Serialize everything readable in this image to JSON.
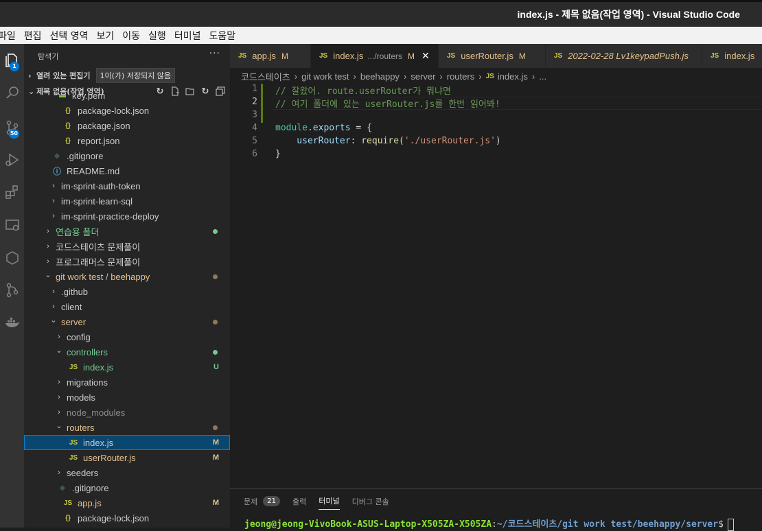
{
  "window": {
    "title": "index.js - 제목 없음(작업 영역) - Visual Studio Code"
  },
  "menu": [
    "파일",
    "편집",
    "선택 영역",
    "보기",
    "이동",
    "실행",
    "터미널",
    "도움말"
  ],
  "activity_bar": [
    {
      "icon": "files-icon",
      "badge": "1"
    },
    {
      "icon": "search-icon",
      "badge": ""
    },
    {
      "icon": "source-control-icon",
      "badge": "50"
    },
    {
      "icon": "run-debug-icon",
      "badge": ""
    },
    {
      "icon": "extensions-icon",
      "badge": ""
    },
    {
      "icon": "remote-explorer-icon",
      "badge": ""
    },
    {
      "icon": "cube-icon",
      "badge": ""
    },
    {
      "icon": "git-graph-icon",
      "badge": ""
    },
    {
      "icon": "docker-icon",
      "badge": ""
    }
  ],
  "sidebar": {
    "header": "탐색기",
    "more": "···",
    "open_editors": {
      "label": "열려 있는 편집기",
      "tooltip": "1이(가) 저장되지 않음"
    },
    "workspace": {
      "label": "제목 없음(작업 영역)"
    },
    "tree": [
      {
        "label": "key.pem",
        "kind": "file",
        "icon": "key-file-icon",
        "indent": 1,
        "color": "white",
        "deco": ""
      },
      {
        "label": "package-lock.json",
        "kind": "json",
        "indent": 1,
        "color": "white",
        "deco": ""
      },
      {
        "label": "package.json",
        "kind": "json",
        "indent": 1,
        "color": "white",
        "deco": ""
      },
      {
        "label": "report.json",
        "kind": "json",
        "indent": 1,
        "color": "white",
        "deco": ""
      },
      {
        "label": ".gitignore",
        "kind": "git",
        "indent": 0,
        "color": "white",
        "deco": ""
      },
      {
        "label": "README.md",
        "kind": "info",
        "indent": 0,
        "color": "white",
        "deco": ""
      },
      {
        "label": "im-sprint-auth-token",
        "kind": "folder",
        "open": false,
        "indent": 0,
        "color": "white",
        "deco": ""
      },
      {
        "label": "im-sprint-learn-sql",
        "kind": "folder",
        "open": false,
        "indent": 0,
        "color": "white",
        "deco": ""
      },
      {
        "label": "im-sprint-practice-deploy",
        "kind": "folder",
        "open": false,
        "indent": 0,
        "color": "white",
        "deco": ""
      },
      {
        "label": "연습용 폴더",
        "kind": "folder",
        "open": false,
        "indent": -1,
        "color": "green",
        "deco": "dot-green"
      },
      {
        "label": "코드스테이츠 문제풀이",
        "kind": "folder",
        "open": false,
        "indent": -1,
        "color": "white",
        "deco": ""
      },
      {
        "label": "프로그래머스 문제풀이",
        "kind": "folder",
        "open": false,
        "indent": -1,
        "color": "white",
        "deco": ""
      },
      {
        "label": "git work test / beehappy",
        "kind": "folder",
        "open": true,
        "indent": -1,
        "color": "mod",
        "deco": "dot-mod"
      },
      {
        "label": ".github",
        "kind": "folder",
        "open": false,
        "indent": 0,
        "color": "white",
        "deco": ""
      },
      {
        "label": "client",
        "kind": "folder",
        "open": false,
        "indent": 0,
        "color": "white",
        "deco": ""
      },
      {
        "label": "server",
        "kind": "folder",
        "open": true,
        "indent": 0,
        "color": "mod",
        "deco": "dot-mod"
      },
      {
        "label": "config",
        "kind": "folder",
        "open": false,
        "indent": 1,
        "color": "white",
        "deco": ""
      },
      {
        "label": "controllers",
        "kind": "folder",
        "open": true,
        "indent": 1,
        "color": "green",
        "deco": "dot-green"
      },
      {
        "label": "index.js",
        "kind": "js",
        "indent": 2,
        "color": "green",
        "deco": "U"
      },
      {
        "label": "migrations",
        "kind": "folder",
        "open": false,
        "indent": 1,
        "color": "white",
        "deco": ""
      },
      {
        "label": "models",
        "kind": "folder",
        "open": false,
        "indent": 1,
        "color": "white",
        "deco": ""
      },
      {
        "label": "node_modules",
        "kind": "folder",
        "open": false,
        "indent": 1,
        "color": "dim",
        "deco": ""
      },
      {
        "label": "routers",
        "kind": "folder",
        "open": true,
        "indent": 1,
        "color": "mod",
        "deco": "dot-mod"
      },
      {
        "label": "index.js",
        "kind": "js",
        "indent": 2,
        "color": "white",
        "deco": "M",
        "selected": true
      },
      {
        "label": "userRouter.js",
        "kind": "js",
        "indent": 2,
        "color": "mod",
        "deco": "M"
      },
      {
        "label": "seeders",
        "kind": "folder",
        "open": false,
        "indent": 1,
        "color": "white",
        "deco": ""
      },
      {
        "label": ".gitignore",
        "kind": "git",
        "indent": 1,
        "color": "white",
        "deco": ""
      },
      {
        "label": "app.js",
        "kind": "js",
        "indent": 1,
        "color": "mod",
        "deco": "M"
      },
      {
        "label": "package-lock.json",
        "kind": "json",
        "indent": 1,
        "color": "white",
        "deco": ""
      }
    ]
  },
  "tabs": [
    {
      "icon": "JS",
      "name": "app.js",
      "path": "",
      "mod": "M",
      "active": false,
      "italic": false,
      "close": ""
    },
    {
      "icon": "JS",
      "name": "index.js",
      "path": ".../routers",
      "mod": "M",
      "active": true,
      "italic": false,
      "close": "✕"
    },
    {
      "icon": "JS",
      "name": "userRouter.js",
      "path": "",
      "mod": "M",
      "active": false,
      "italic": false,
      "close": ""
    },
    {
      "icon": "JS",
      "name": "2022-02-28 Lv1keypadPush.js",
      "path": "",
      "mod": "",
      "active": false,
      "italic": true,
      "close": ""
    },
    {
      "icon": "JS",
      "name": "index.js",
      "path": "",
      "mod": "",
      "active": false,
      "italic": false,
      "close": ""
    }
  ],
  "breadcrumb": [
    "코드스테이츠",
    "git work test",
    "beehappy",
    "server",
    "routers",
    "index.js",
    "..."
  ],
  "code": [
    {
      "n": "1",
      "tokens": [
        {
          "t": "// 잘왔어. route.userRouter가 뭐냐면",
          "c": "comment"
        }
      ],
      "mark": true
    },
    {
      "n": "2",
      "tokens": [
        {
          "t": "// 여기 폴더에 있는 userRouter.js를 한번 읽어봐!",
          "c": "comment"
        }
      ],
      "mark": true,
      "current": true
    },
    {
      "n": "3",
      "tokens": [],
      "mark": true
    },
    {
      "n": "4",
      "tokens": [
        {
          "t": "module",
          "c": "module"
        },
        {
          "t": ".",
          "c": "plain"
        },
        {
          "t": "exports",
          "c": "prop"
        },
        {
          "t": " = {",
          "c": "plain"
        }
      ]
    },
    {
      "n": "5",
      "tokens": [
        {
          "t": "    userRouter",
          "c": "prop"
        },
        {
          "t": ": ",
          "c": "plain"
        },
        {
          "t": "require",
          "c": "func"
        },
        {
          "t": "(",
          "c": "plain"
        },
        {
          "t": "'./userRouter.js'",
          "c": "str"
        },
        {
          "t": ")",
          "c": "plain"
        }
      ]
    },
    {
      "n": "6",
      "tokens": [
        {
          "t": "}",
          "c": "plain"
        }
      ]
    }
  ],
  "panel": {
    "tabs": [
      {
        "label": "문제",
        "badge": "21",
        "active": false
      },
      {
        "label": "출력",
        "badge": "",
        "active": false
      },
      {
        "label": "터미널",
        "badge": "",
        "active": true
      },
      {
        "label": "디버그 콘솔",
        "badge": "",
        "active": false
      }
    ],
    "terminal": {
      "user": "jeong@jeong-VivoBook-ASUS-Laptop-X505ZA-X505ZA",
      "sep": ":",
      "path": "~/코드스테이츠/git work test/beehappy/server",
      "prompt": "$"
    }
  }
}
